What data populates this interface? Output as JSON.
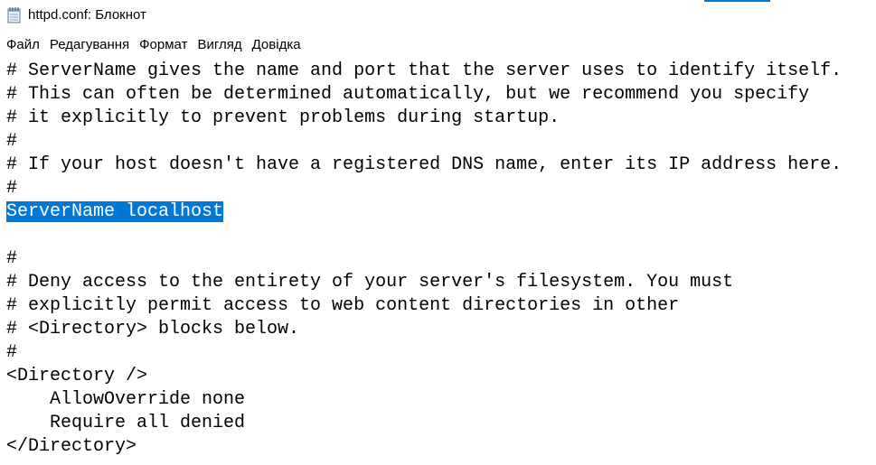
{
  "window": {
    "title": "httpd.conf: Блокнот",
    "accent_color": "#0078d7",
    "icon": "notepad-icon"
  },
  "menu": {
    "items": [
      {
        "label": "Файл"
      },
      {
        "label": "Редагування"
      },
      {
        "label": "Формат"
      },
      {
        "label": "Вигляд"
      },
      {
        "label": "Довідка"
      }
    ]
  },
  "editor": {
    "selection_color": "#0078d7",
    "lines": [
      {
        "text": "# ServerName gives the name and port that the server uses to identify itself.",
        "selected": false
      },
      {
        "text": "# This can often be determined automatically, but we recommend you specify",
        "selected": false
      },
      {
        "text": "# it explicitly to prevent problems during startup.",
        "selected": false
      },
      {
        "text": "#",
        "selected": false
      },
      {
        "text": "# If your host doesn't have a registered DNS name, enter its IP address here.",
        "selected": false
      },
      {
        "text": "#",
        "selected": false
      },
      {
        "text": "ServerName localhost",
        "selected": true
      },
      {
        "text": "",
        "selected": false
      },
      {
        "text": "#",
        "selected": false
      },
      {
        "text": "# Deny access to the entirety of your server's filesystem. You must",
        "selected": false
      },
      {
        "text": "# explicitly permit access to web content directories in other",
        "selected": false
      },
      {
        "text": "# <Directory> blocks below.",
        "selected": false
      },
      {
        "text": "#",
        "selected": false
      },
      {
        "text": "<Directory />",
        "selected": false
      },
      {
        "text": "    AllowOverride none",
        "selected": false
      },
      {
        "text": "    Require all denied",
        "selected": false
      },
      {
        "text": "</Directory>",
        "selected": false
      }
    ]
  }
}
